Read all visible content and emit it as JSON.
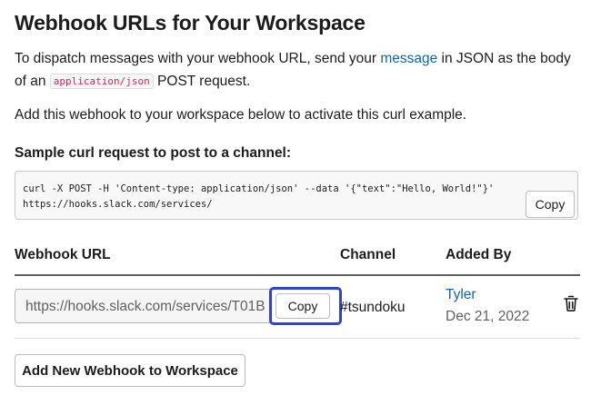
{
  "page": {
    "title": "Webhook URLs for Your Workspace",
    "intro_1": "To dispatch messages with your webhook URL, send your ",
    "intro_link": "message",
    "intro_2": " in JSON as the body of an ",
    "intro_code": "application/json",
    "intro_3": " POST request.",
    "activate_text": "Add this webhook to your workspace below to activate this curl example."
  },
  "sample": {
    "title": "Sample curl request to post to a channel:",
    "curl_line1": "curl -X POST -H 'Content-type: application/json' --data '{\"text\":\"Hello, World!\"}'",
    "curl_line2": "https://hooks.slack.com/services/",
    "copy_label": "Copy"
  },
  "table": {
    "headers": [
      "Webhook URL",
      "Channel",
      "Added By"
    ],
    "rows": [
      {
        "url": "https://hooks.slack.com/services/T01B",
        "copy_label": "Copy",
        "channel": "#tsundoku",
        "added_by": "Tyler",
        "added_date": "Dec 21, 2022"
      }
    ]
  },
  "actions": {
    "add_webhook_label": "Add New Webhook to Workspace"
  },
  "icons": {
    "row_delete": "trash-icon"
  },
  "colors": {
    "link": "#1264a3",
    "code": "#e01e5a",
    "focus": "#2e43d6"
  }
}
